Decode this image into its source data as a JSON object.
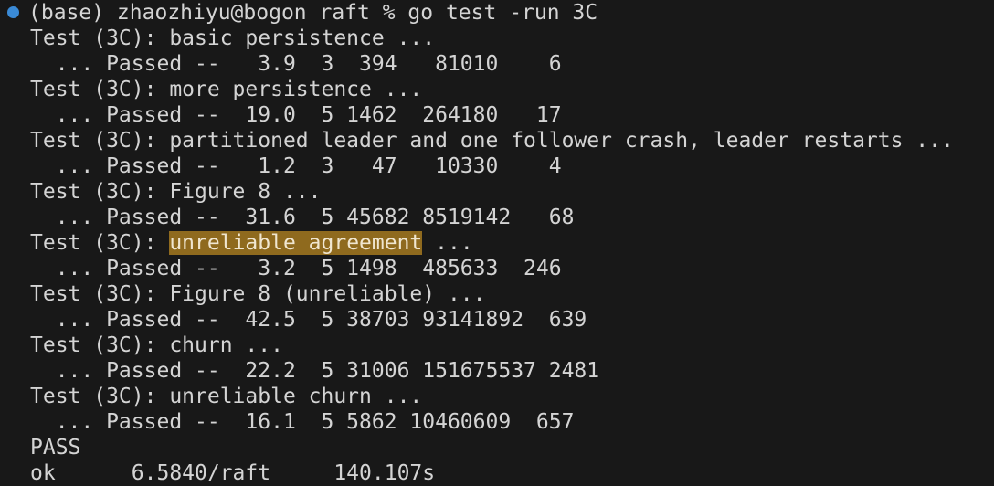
{
  "colors": {
    "background": "#181818",
    "text": "#d4d4d4",
    "prompt_dot": "#3a8ad6",
    "highlight": "#8f6a1e"
  },
  "prompt": {
    "icon": "status-dot-icon",
    "text": "(base) zhaozhiyu@bogon raft % go test -run 3C"
  },
  "lines": [
    {
      "test": "Test (3C): basic persistence ...",
      "result": "  ... Passed --   3.9  3  394   81010    6"
    },
    {
      "test": "Test (3C): more persistence ...",
      "result": "  ... Passed --  19.0  5 1462  264180   17"
    },
    {
      "test": "Test (3C): partitioned leader and one follower crash, leader restarts ...",
      "result": "  ... Passed --   1.2  3   47   10330    4"
    },
    {
      "test": "Test (3C): Figure 8 ...",
      "result": "  ... Passed --  31.6  5 45682 8519142   68"
    },
    {
      "test_prefix": "Test (3C): ",
      "test_highlight": "unreliable agreement",
      "test_suffix": " ...",
      "result": "  ... Passed --   3.2  5 1498  485633  246"
    },
    {
      "test": "Test (3C): Figure 8 (unreliable) ...",
      "result": "  ... Passed --  42.5  5 38703 93141892  639"
    },
    {
      "test": "Test (3C): churn ...",
      "result": "  ... Passed --  22.2  5 31006 151675537 2481"
    },
    {
      "test": "Test (3C): unreliable churn ...",
      "result": "  ... Passed --  16.1  5 5862 10460609  657"
    }
  ],
  "pass_text": "PASS",
  "ok_line": "ok      6.5840/raft     140.107s"
}
